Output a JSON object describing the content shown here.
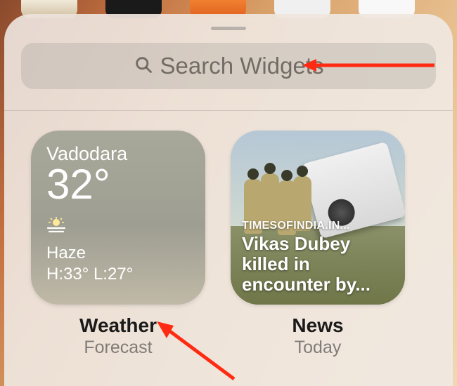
{
  "search": {
    "placeholder": "Search Widgets"
  },
  "widgets": [
    {
      "kind": "weather",
      "city": "Vadodara",
      "temp": "32°",
      "icon_glyph": "haze",
      "condition": "Haze",
      "highlow": "H:33° L:27°",
      "caption_title": "Weather",
      "caption_sub": "Forecast"
    },
    {
      "kind": "news",
      "source": "TIMESOFINDIA.IN...",
      "headline": "Vikas Dubey killed in encounter by...",
      "caption_title": "News",
      "caption_sub": "Today"
    }
  ],
  "annotations": {
    "arrow1_color": "#ff2a12",
    "arrow2_color": "#ff2a12"
  }
}
